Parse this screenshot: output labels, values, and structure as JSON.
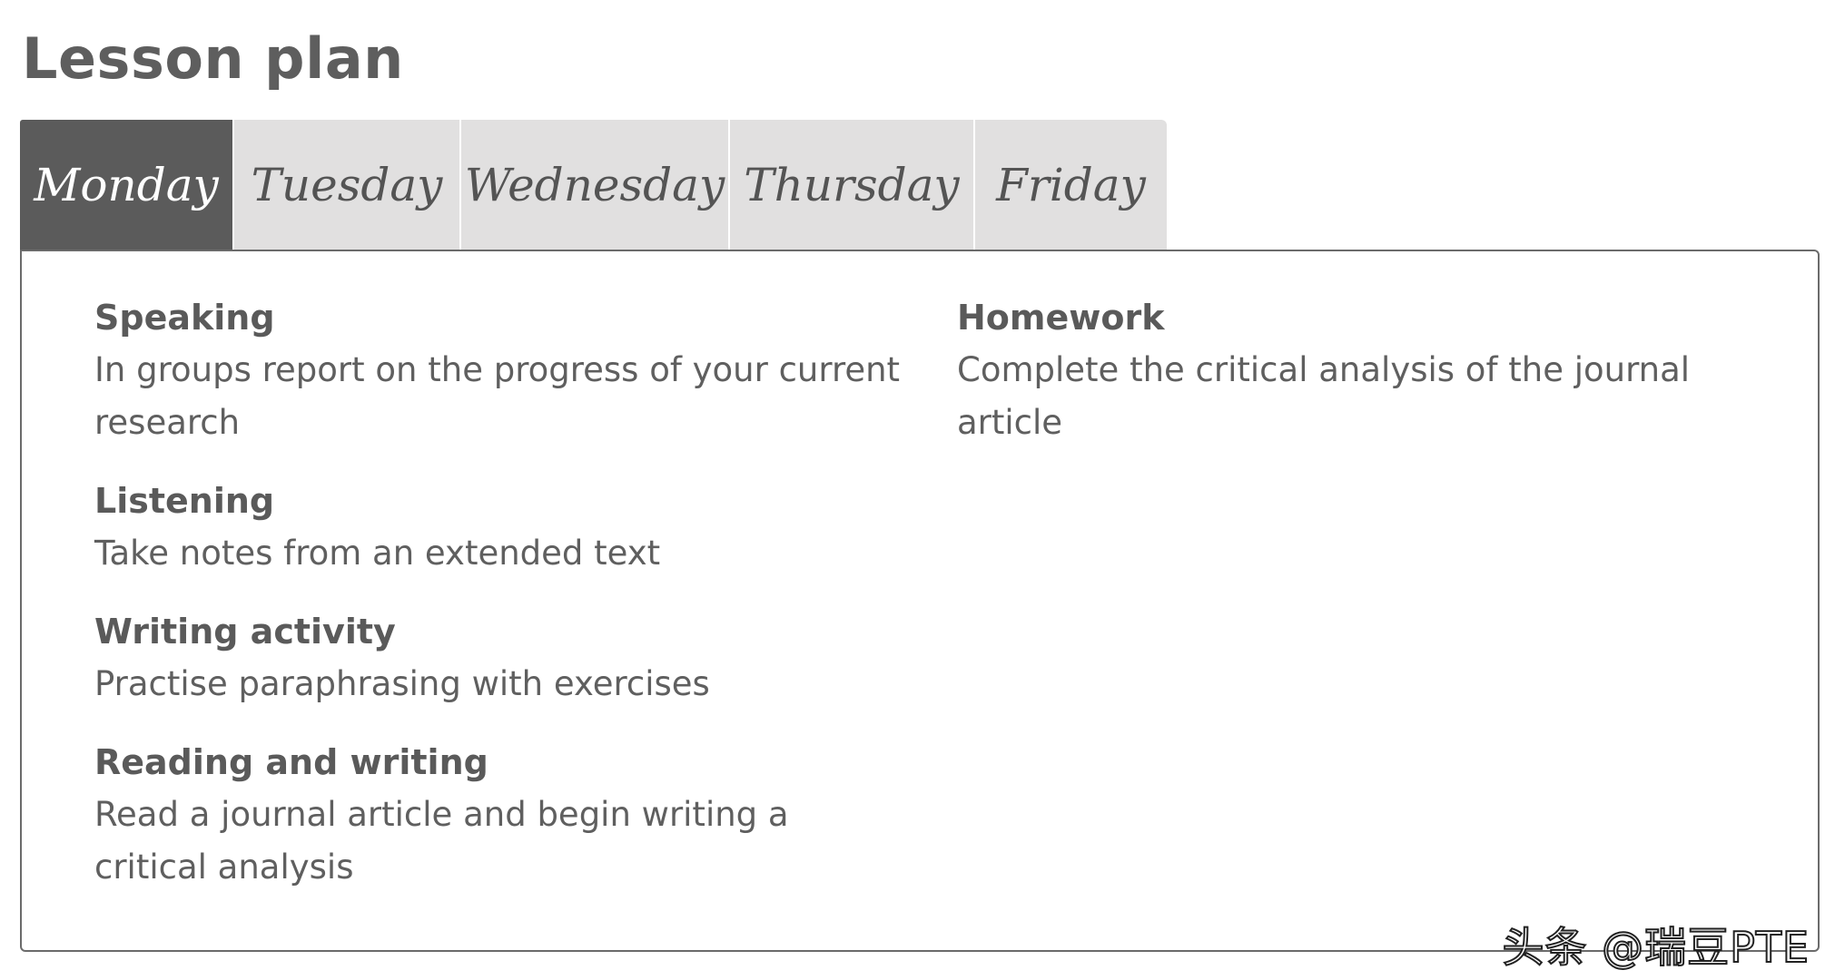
{
  "title": "Lesson plan",
  "tabs": [
    {
      "label": "Monday",
      "active": true
    },
    {
      "label": "Tuesday",
      "active": false
    },
    {
      "label": "Wednesday",
      "active": false
    },
    {
      "label": "Thursday",
      "active": false
    },
    {
      "label": "Friday",
      "active": false
    }
  ],
  "panel": {
    "left": [
      {
        "heading": "Speaking",
        "body": "In groups report on the progress of your current research"
      },
      {
        "heading": "Listening",
        "body": "Take notes from an extended text"
      },
      {
        "heading": "Writing activity",
        "body": "Practise paraphrasing with exercises"
      },
      {
        "heading": "Reading and writing",
        "body": "Read a journal article and begin writing a critical analysis"
      }
    ],
    "right": [
      {
        "heading": "Homework",
        "body": "Complete the critical analysis of the journal article"
      }
    ]
  },
  "watermark": "头条 @瑞豆PTE",
  "colors": {
    "active_tab": "#5b5b5b",
    "inactive_tab": "#e1e0e0",
    "text": "#5a5a5a",
    "border": "#6b6b6b"
  }
}
